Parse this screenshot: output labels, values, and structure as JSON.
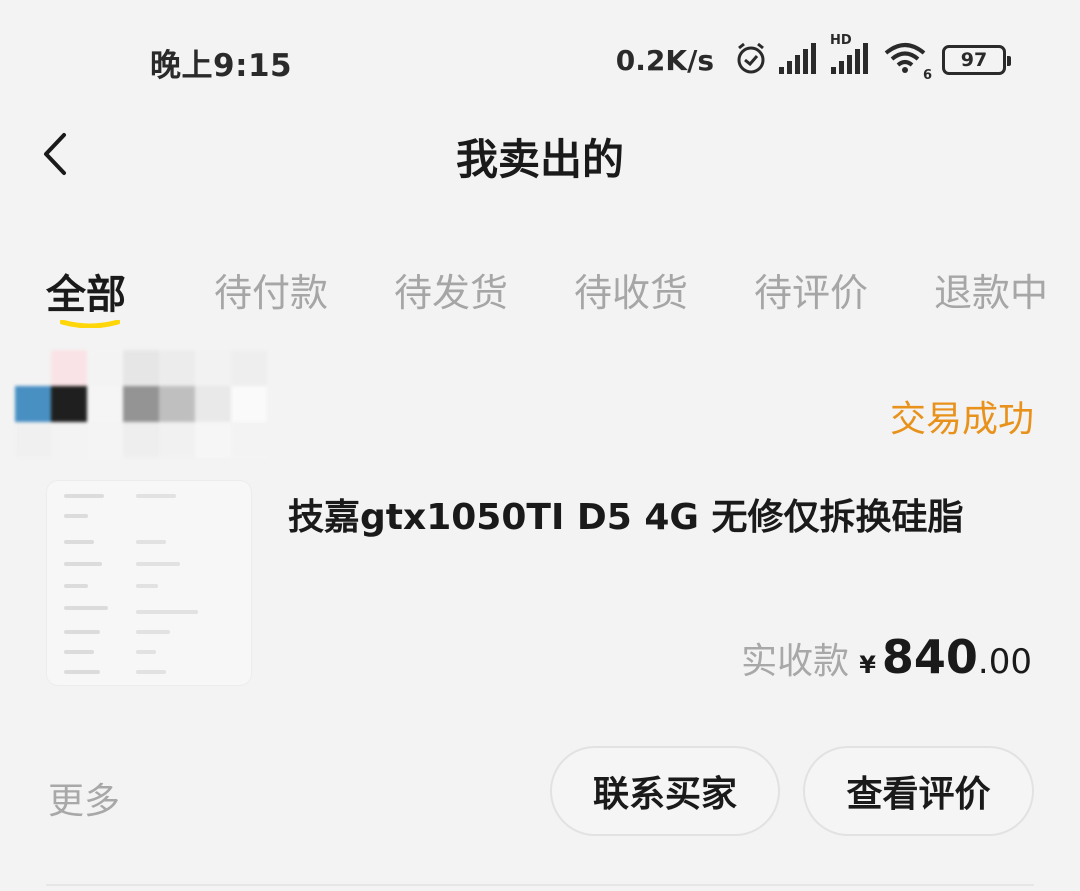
{
  "status_bar": {
    "time": "晚上9:15",
    "net_speed": "0.2K/s",
    "network_type": "HD",
    "wifi_label": "6",
    "battery": "97"
  },
  "header": {
    "title": "我卖出的"
  },
  "tabs": [
    {
      "label": "全部",
      "active": true
    },
    {
      "label": "待付款",
      "active": false
    },
    {
      "label": "待发货",
      "active": false
    },
    {
      "label": "待收货",
      "active": false
    },
    {
      "label": "待评价",
      "active": false
    },
    {
      "label": "退款中",
      "active": false
    }
  ],
  "order": {
    "status": "交易成功",
    "product_title": "技嘉gtx1050TI D5 4G 无修仅拆换硅脂",
    "price_label": "实收款",
    "currency": "¥",
    "price_integer": "840",
    "price_decimal": ".00",
    "more_label": "更多",
    "contact_buyer_label": "联系买家",
    "view_review_label": "查看评价"
  },
  "colors": {
    "accent_yellow": "#ffd60a",
    "status_orange": "#e8921c",
    "muted_text": "#a8a8a8"
  }
}
